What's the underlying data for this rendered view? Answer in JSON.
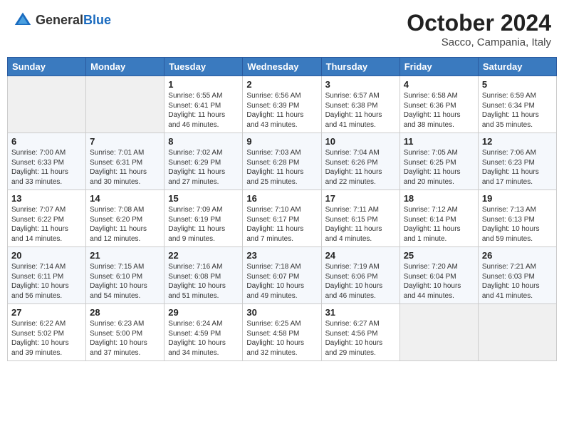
{
  "header": {
    "logo_general": "General",
    "logo_blue": "Blue",
    "month_title": "October 2024",
    "location": "Sacco, Campania, Italy"
  },
  "days_of_week": [
    "Sunday",
    "Monday",
    "Tuesday",
    "Wednesday",
    "Thursday",
    "Friday",
    "Saturday"
  ],
  "weeks": [
    [
      null,
      null,
      {
        "day": 1,
        "sunrise": "Sunrise: 6:55 AM",
        "sunset": "Sunset: 6:41 PM",
        "daylight": "Daylight: 11 hours and 46 minutes."
      },
      {
        "day": 2,
        "sunrise": "Sunrise: 6:56 AM",
        "sunset": "Sunset: 6:39 PM",
        "daylight": "Daylight: 11 hours and 43 minutes."
      },
      {
        "day": 3,
        "sunrise": "Sunrise: 6:57 AM",
        "sunset": "Sunset: 6:38 PM",
        "daylight": "Daylight: 11 hours and 41 minutes."
      },
      {
        "day": 4,
        "sunrise": "Sunrise: 6:58 AM",
        "sunset": "Sunset: 6:36 PM",
        "daylight": "Daylight: 11 hours and 38 minutes."
      },
      {
        "day": 5,
        "sunrise": "Sunrise: 6:59 AM",
        "sunset": "Sunset: 6:34 PM",
        "daylight": "Daylight: 11 hours and 35 minutes."
      }
    ],
    [
      {
        "day": 6,
        "sunrise": "Sunrise: 7:00 AM",
        "sunset": "Sunset: 6:33 PM",
        "daylight": "Daylight: 11 hours and 33 minutes."
      },
      {
        "day": 7,
        "sunrise": "Sunrise: 7:01 AM",
        "sunset": "Sunset: 6:31 PM",
        "daylight": "Daylight: 11 hours and 30 minutes."
      },
      {
        "day": 8,
        "sunrise": "Sunrise: 7:02 AM",
        "sunset": "Sunset: 6:29 PM",
        "daylight": "Daylight: 11 hours and 27 minutes."
      },
      {
        "day": 9,
        "sunrise": "Sunrise: 7:03 AM",
        "sunset": "Sunset: 6:28 PM",
        "daylight": "Daylight: 11 hours and 25 minutes."
      },
      {
        "day": 10,
        "sunrise": "Sunrise: 7:04 AM",
        "sunset": "Sunset: 6:26 PM",
        "daylight": "Daylight: 11 hours and 22 minutes."
      },
      {
        "day": 11,
        "sunrise": "Sunrise: 7:05 AM",
        "sunset": "Sunset: 6:25 PM",
        "daylight": "Daylight: 11 hours and 20 minutes."
      },
      {
        "day": 12,
        "sunrise": "Sunrise: 7:06 AM",
        "sunset": "Sunset: 6:23 PM",
        "daylight": "Daylight: 11 hours and 17 minutes."
      }
    ],
    [
      {
        "day": 13,
        "sunrise": "Sunrise: 7:07 AM",
        "sunset": "Sunset: 6:22 PM",
        "daylight": "Daylight: 11 hours and 14 minutes."
      },
      {
        "day": 14,
        "sunrise": "Sunrise: 7:08 AM",
        "sunset": "Sunset: 6:20 PM",
        "daylight": "Daylight: 11 hours and 12 minutes."
      },
      {
        "day": 15,
        "sunrise": "Sunrise: 7:09 AM",
        "sunset": "Sunset: 6:19 PM",
        "daylight": "Daylight: 11 hours and 9 minutes."
      },
      {
        "day": 16,
        "sunrise": "Sunrise: 7:10 AM",
        "sunset": "Sunset: 6:17 PM",
        "daylight": "Daylight: 11 hours and 7 minutes."
      },
      {
        "day": 17,
        "sunrise": "Sunrise: 7:11 AM",
        "sunset": "Sunset: 6:15 PM",
        "daylight": "Daylight: 11 hours and 4 minutes."
      },
      {
        "day": 18,
        "sunrise": "Sunrise: 7:12 AM",
        "sunset": "Sunset: 6:14 PM",
        "daylight": "Daylight: 11 hours and 1 minute."
      },
      {
        "day": 19,
        "sunrise": "Sunrise: 7:13 AM",
        "sunset": "Sunset: 6:13 PM",
        "daylight": "Daylight: 10 hours and 59 minutes."
      }
    ],
    [
      {
        "day": 20,
        "sunrise": "Sunrise: 7:14 AM",
        "sunset": "Sunset: 6:11 PM",
        "daylight": "Daylight: 10 hours and 56 minutes."
      },
      {
        "day": 21,
        "sunrise": "Sunrise: 7:15 AM",
        "sunset": "Sunset: 6:10 PM",
        "daylight": "Daylight: 10 hours and 54 minutes."
      },
      {
        "day": 22,
        "sunrise": "Sunrise: 7:16 AM",
        "sunset": "Sunset: 6:08 PM",
        "daylight": "Daylight: 10 hours and 51 minutes."
      },
      {
        "day": 23,
        "sunrise": "Sunrise: 7:18 AM",
        "sunset": "Sunset: 6:07 PM",
        "daylight": "Daylight: 10 hours and 49 minutes."
      },
      {
        "day": 24,
        "sunrise": "Sunrise: 7:19 AM",
        "sunset": "Sunset: 6:06 PM",
        "daylight": "Daylight: 10 hours and 46 minutes."
      },
      {
        "day": 25,
        "sunrise": "Sunrise: 7:20 AM",
        "sunset": "Sunset: 6:04 PM",
        "daylight": "Daylight: 10 hours and 44 minutes."
      },
      {
        "day": 26,
        "sunrise": "Sunrise: 7:21 AM",
        "sunset": "Sunset: 6:03 PM",
        "daylight": "Daylight: 10 hours and 41 minutes."
      }
    ],
    [
      {
        "day": 27,
        "sunrise": "Sunrise: 6:22 AM",
        "sunset": "Sunset: 5:02 PM",
        "daylight": "Daylight: 10 hours and 39 minutes."
      },
      {
        "day": 28,
        "sunrise": "Sunrise: 6:23 AM",
        "sunset": "Sunset: 5:00 PM",
        "daylight": "Daylight: 10 hours and 37 minutes."
      },
      {
        "day": 29,
        "sunrise": "Sunrise: 6:24 AM",
        "sunset": "Sunset: 4:59 PM",
        "daylight": "Daylight: 10 hours and 34 minutes."
      },
      {
        "day": 30,
        "sunrise": "Sunrise: 6:25 AM",
        "sunset": "Sunset: 4:58 PM",
        "daylight": "Daylight: 10 hours and 32 minutes."
      },
      {
        "day": 31,
        "sunrise": "Sunrise: 6:27 AM",
        "sunset": "Sunset: 4:56 PM",
        "daylight": "Daylight: 10 hours and 29 minutes."
      },
      null,
      null
    ]
  ]
}
